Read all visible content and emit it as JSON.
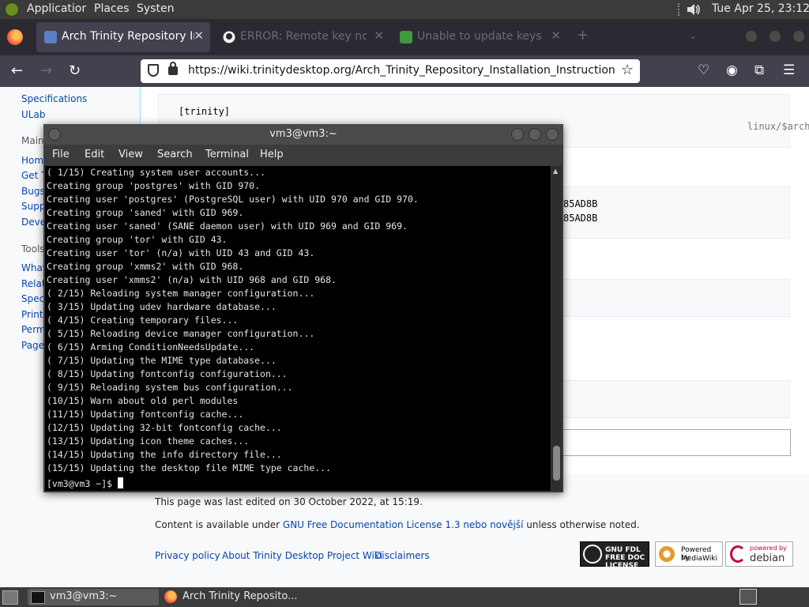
{
  "top_panel": {
    "applications": "Applicatior",
    "places": "Places",
    "system": "Systen",
    "datetime": "Tue Apr 25, 23:12"
  },
  "browser": {
    "tabs": [
      {
        "label": "Arch Trinity Repository Ins",
        "active": true
      },
      {
        "label": "ERROR: Remote key not",
        "active": false
      },
      {
        "label": "Unable to update keys",
        "active": false
      }
    ],
    "url": "https://wiki.trinitydesktop.org/Arch_Trinity_Repository_Installation_Instructions"
  },
  "wiki": {
    "sidebar": {
      "links_top": [
        "Specifications",
        "ULab"
      ],
      "main_heading": "Main",
      "main_links": [
        "Home",
        "Get T",
        "Bugs",
        "Supp",
        "Deve"
      ],
      "tools_heading": "Tools",
      "tools_links": [
        "What",
        "Relat",
        "Spec",
        "Print",
        "Perm",
        "Page"
      ]
    },
    "code1_line1": "[trinity]",
    "code1_line2_tail": "linux/$arch",
    "code2_line1": "85AD8B",
    "code2_line2": "85AD8B",
    "footer": {
      "last_edited": "This page was last edited on 30 October 2022, at 15:19.",
      "content_prefix": "Content is available under ",
      "license_link": "GNU Free Documentation License 1.3 nebo novější",
      "content_suffix": " unless otherwise noted.",
      "links": [
        "Privacy policy",
        "About Trinity Desktop Project Wiki",
        "Disclaimers"
      ],
      "badge_gfdl": "GNU FDL FREE DOC LICENSE",
      "badge_mediawiki_top": "Powered by",
      "badge_mediawiki_bottom": "MediaWiki",
      "badge_debian_top": "powered by",
      "badge_debian_bottom": "debian"
    }
  },
  "terminal": {
    "title": "vm3@vm3:~",
    "menu": [
      "File",
      "Edit",
      "View",
      "Search",
      "Terminal",
      "Help"
    ],
    "lines": [
      "( 1/15) Creating system user accounts...",
      "Creating group 'postgres' with GID 970.",
      "Creating user 'postgres' (PostgreSQL user) with UID 970 and GID 970.",
      "Creating group 'saned' with GID 969.",
      "Creating user 'saned' (SANE daemon user) with UID 969 and GID 969.",
      "Creating group 'tor' with GID 43.",
      "Creating user 'tor' (n/a) with UID 43 and GID 43.",
      "Creating group 'xmms2' with GID 968.",
      "Creating user 'xmms2' (n/a) with UID 968 and GID 968.",
      "( 2/15) Reloading system manager configuration...",
      "( 3/15) Updating udev hardware database...",
      "( 4/15) Creating temporary files...",
      "( 5/15) Reloading device manager configuration...",
      "( 6/15) Arming ConditionNeedsUpdate...",
      "( 7/15) Updating the MIME type database...",
      "( 8/15) Updating fontconfig configuration...",
      "( 9/15) Reloading system bus configuration...",
      "(10/15) Warn about old perl modules",
      "(11/15) Updating fontconfig cache...",
      "(12/15) Updating 32-bit fontconfig cache...",
      "(13/15) Updating icon theme caches...",
      "(14/15) Updating the info directory file...",
      "(15/15) Updating the desktop file MIME type cache..."
    ],
    "prompt": "[vm3@vm3 ~]$ "
  },
  "bottom_panel": {
    "tasks": [
      "vm3@vm3:~",
      "Arch Trinity Reposito..."
    ]
  },
  "colors": {
    "panel": "#3b3b3b",
    "link": "#0645ad",
    "terminal_bg": "#000000"
  }
}
